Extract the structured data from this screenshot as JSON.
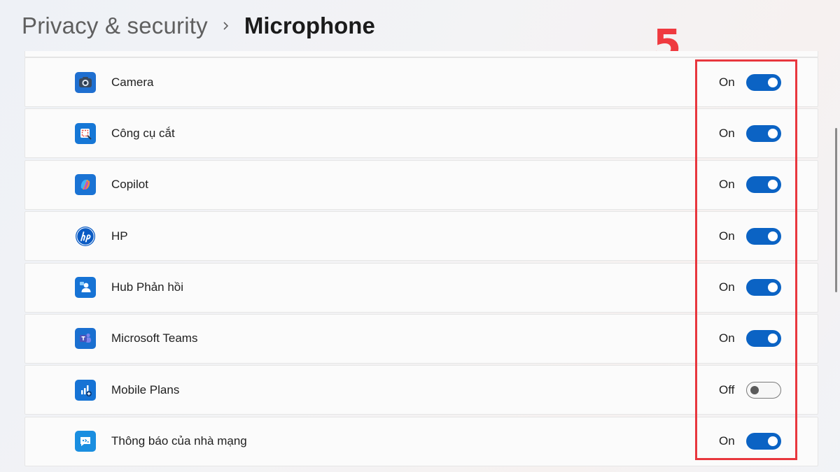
{
  "breadcrumb": {
    "parent": "Privacy & security",
    "current": "Microphone"
  },
  "annotation": {
    "label": "5",
    "color": "#ef3a3f"
  },
  "colors": {
    "toggle_on": "#0b63c4",
    "highlight_box": "#e8373e"
  },
  "apps": [
    {
      "name": "Camera",
      "state": "On",
      "enabled": true,
      "icon": "camera-app-icon"
    },
    {
      "name": "Công cụ cắt",
      "state": "On",
      "enabled": true,
      "icon": "snipping-tool-icon"
    },
    {
      "name": "Copilot",
      "state": "On",
      "enabled": true,
      "icon": "copilot-icon"
    },
    {
      "name": "HP",
      "state": "On",
      "enabled": true,
      "icon": "hp-logo-icon"
    },
    {
      "name": "Hub Phản hồi",
      "state": "On",
      "enabled": true,
      "icon": "feedback-hub-icon"
    },
    {
      "name": "Microsoft Teams",
      "state": "On",
      "enabled": true,
      "icon": "teams-icon"
    },
    {
      "name": "Mobile Plans",
      "state": "Off",
      "enabled": false,
      "icon": "mobile-plans-icon"
    },
    {
      "name": "Thông báo của nhà mạng",
      "state": "On",
      "enabled": true,
      "icon": "carrier-messages-icon"
    }
  ]
}
